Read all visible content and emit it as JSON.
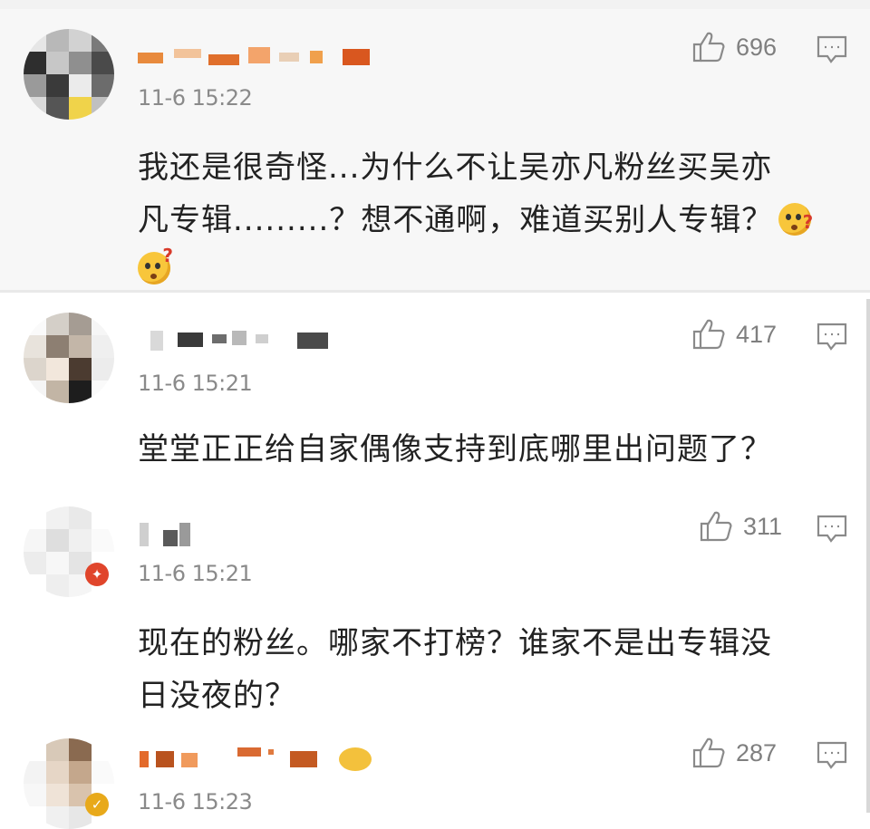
{
  "comments": [
    {
      "time": "11-6 15:22",
      "likes": "696",
      "text_line1": "我还是很奇怪...为什么不让吴亦凡粉丝买吴亦",
      "text_line2": "凡专辑.........？想不通啊，难道买别人专辑？",
      "emoji_icon": "thinking-face-icon"
    },
    {
      "time": "11-6 15:21",
      "likes": "417",
      "text_line1": "堂堂正正给自家偶像支持到底哪里出问题了？"
    },
    {
      "time": "11-6 15:21",
      "likes": "311",
      "text_line1": "现在的粉丝。哪家不打榜？谁家不是出专辑没",
      "text_line2": "日没夜的？"
    },
    {
      "time": "11-6 15:23",
      "likes": "287"
    }
  ],
  "icons": {
    "like": "thumbs-up-icon",
    "reply": "comment-bubble-icon"
  },
  "colors": {
    "text": "#222222",
    "meta": "#8a8a8a",
    "icon": "#7f7f7f"
  }
}
